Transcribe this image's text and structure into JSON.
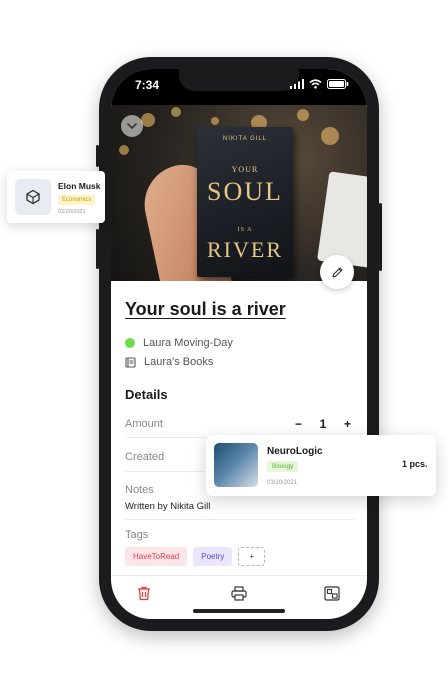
{
  "status_bar": {
    "time": "7:34",
    "icons": [
      "signal-icon",
      "wifi-icon",
      "battery-icon"
    ]
  },
  "cover": {
    "book_author": "NIKITA GILL",
    "book_word_1": "YOUR",
    "book_word_2": "SOUL",
    "book_word_3": "IS A",
    "book_word_4": "RIVER"
  },
  "book": {
    "title": "Your soul is a river",
    "owner": "Laura Moving-Day",
    "library": "Laura's Books"
  },
  "details": {
    "heading": "Details",
    "amount_label": "Amount",
    "amount_value": "1",
    "decrement": "−",
    "increment": "+",
    "created_label": "Created",
    "notes_label": "Notes",
    "notes_value": "Written by Nikita Gill",
    "tags_label": "Tags",
    "tags": [
      "HaveToRead",
      "Poetry"
    ],
    "add_tag": "+"
  },
  "floating_cards": {
    "elon": {
      "name": "Elon Musk",
      "tag": "Economics",
      "date": "03/20/2021"
    },
    "neuro": {
      "name": "NeuroLogic",
      "tag": "Biology",
      "date": "03/20/2021",
      "quantity": "1 pcs."
    }
  },
  "toolbar": {
    "icons": [
      "trash-icon",
      "printer-icon",
      "move-icon"
    ]
  },
  "colors": {
    "owner_dot": "#6ddd48",
    "tag_red_bg": "#fde6e8",
    "tag_red_text": "#e13a48",
    "tag_blue_bg": "#ebe6fd",
    "tag_blue_text": "#5b4bd8",
    "trash": "#e33a3a"
  }
}
